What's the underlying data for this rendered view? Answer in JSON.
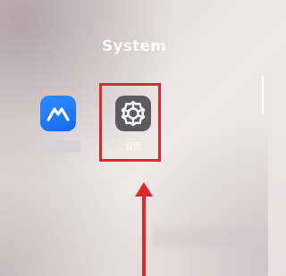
{
  "folder": {
    "title": "System"
  },
  "apps": [
    {
      "name": "blue-app",
      "icon": "mountain-icon",
      "color": "#1a73f5"
    },
    {
      "name": "settings",
      "label": "设置",
      "icon": "gear-icon",
      "color": "#5b5b60"
    }
  ],
  "annotation": {
    "color": "#e4252b"
  }
}
